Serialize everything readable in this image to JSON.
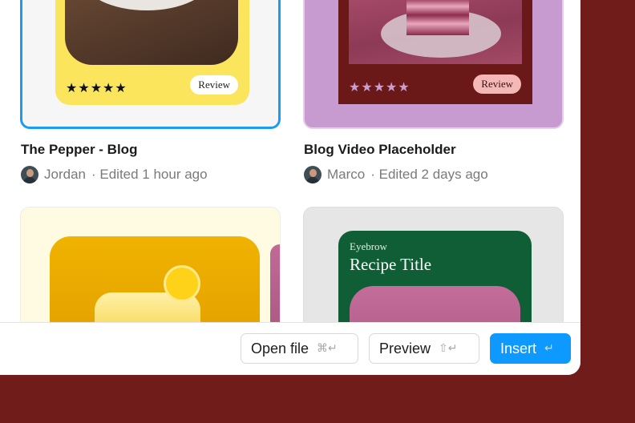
{
  "cards": [
    {
      "title": "The Pepper - Blog",
      "author": "Jordan",
      "edited": "· Edited 1 hour ago",
      "review": "Review",
      "stars": "★★★★★"
    },
    {
      "title": "Blog Video Placeholder",
      "author": "Marco",
      "edited": "· Edited 2 days ago",
      "review": "Review",
      "stars": "★★★★★"
    }
  ],
  "recipe_card": {
    "eyebrow": "Eyebrow",
    "title": "Recipe Title"
  },
  "footer": {
    "open_file": {
      "label": "Open file",
      "shortcut": "⌘↵"
    },
    "preview": {
      "label": "Preview",
      "shortcut": "⇧↵"
    },
    "insert": {
      "label": "Insert",
      "shortcut": "↵"
    }
  },
  "colors": {
    "background": "#6f1c1a",
    "selection_border": "#1d9bf0",
    "primary_button": "#0d99ff",
    "card1_yellow": "#fbe55c",
    "card2_purple": "#c89bd0",
    "card2_maroon": "#6a1818",
    "recipe_green": "#0f5e35"
  }
}
